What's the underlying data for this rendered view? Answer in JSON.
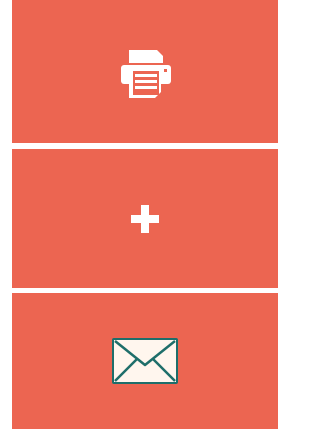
{
  "colors": {
    "tile_background": "#EC6551",
    "icon_fill": "#FFFFFF",
    "mail_icon_fill": "#FFF6EE",
    "mail_icon_stroke": "#1E6E6A"
  },
  "actions": [
    {
      "id": "print",
      "icon": "printer-icon"
    },
    {
      "id": "add",
      "icon": "plus-icon"
    },
    {
      "id": "email",
      "icon": "envelope-icon"
    }
  ]
}
